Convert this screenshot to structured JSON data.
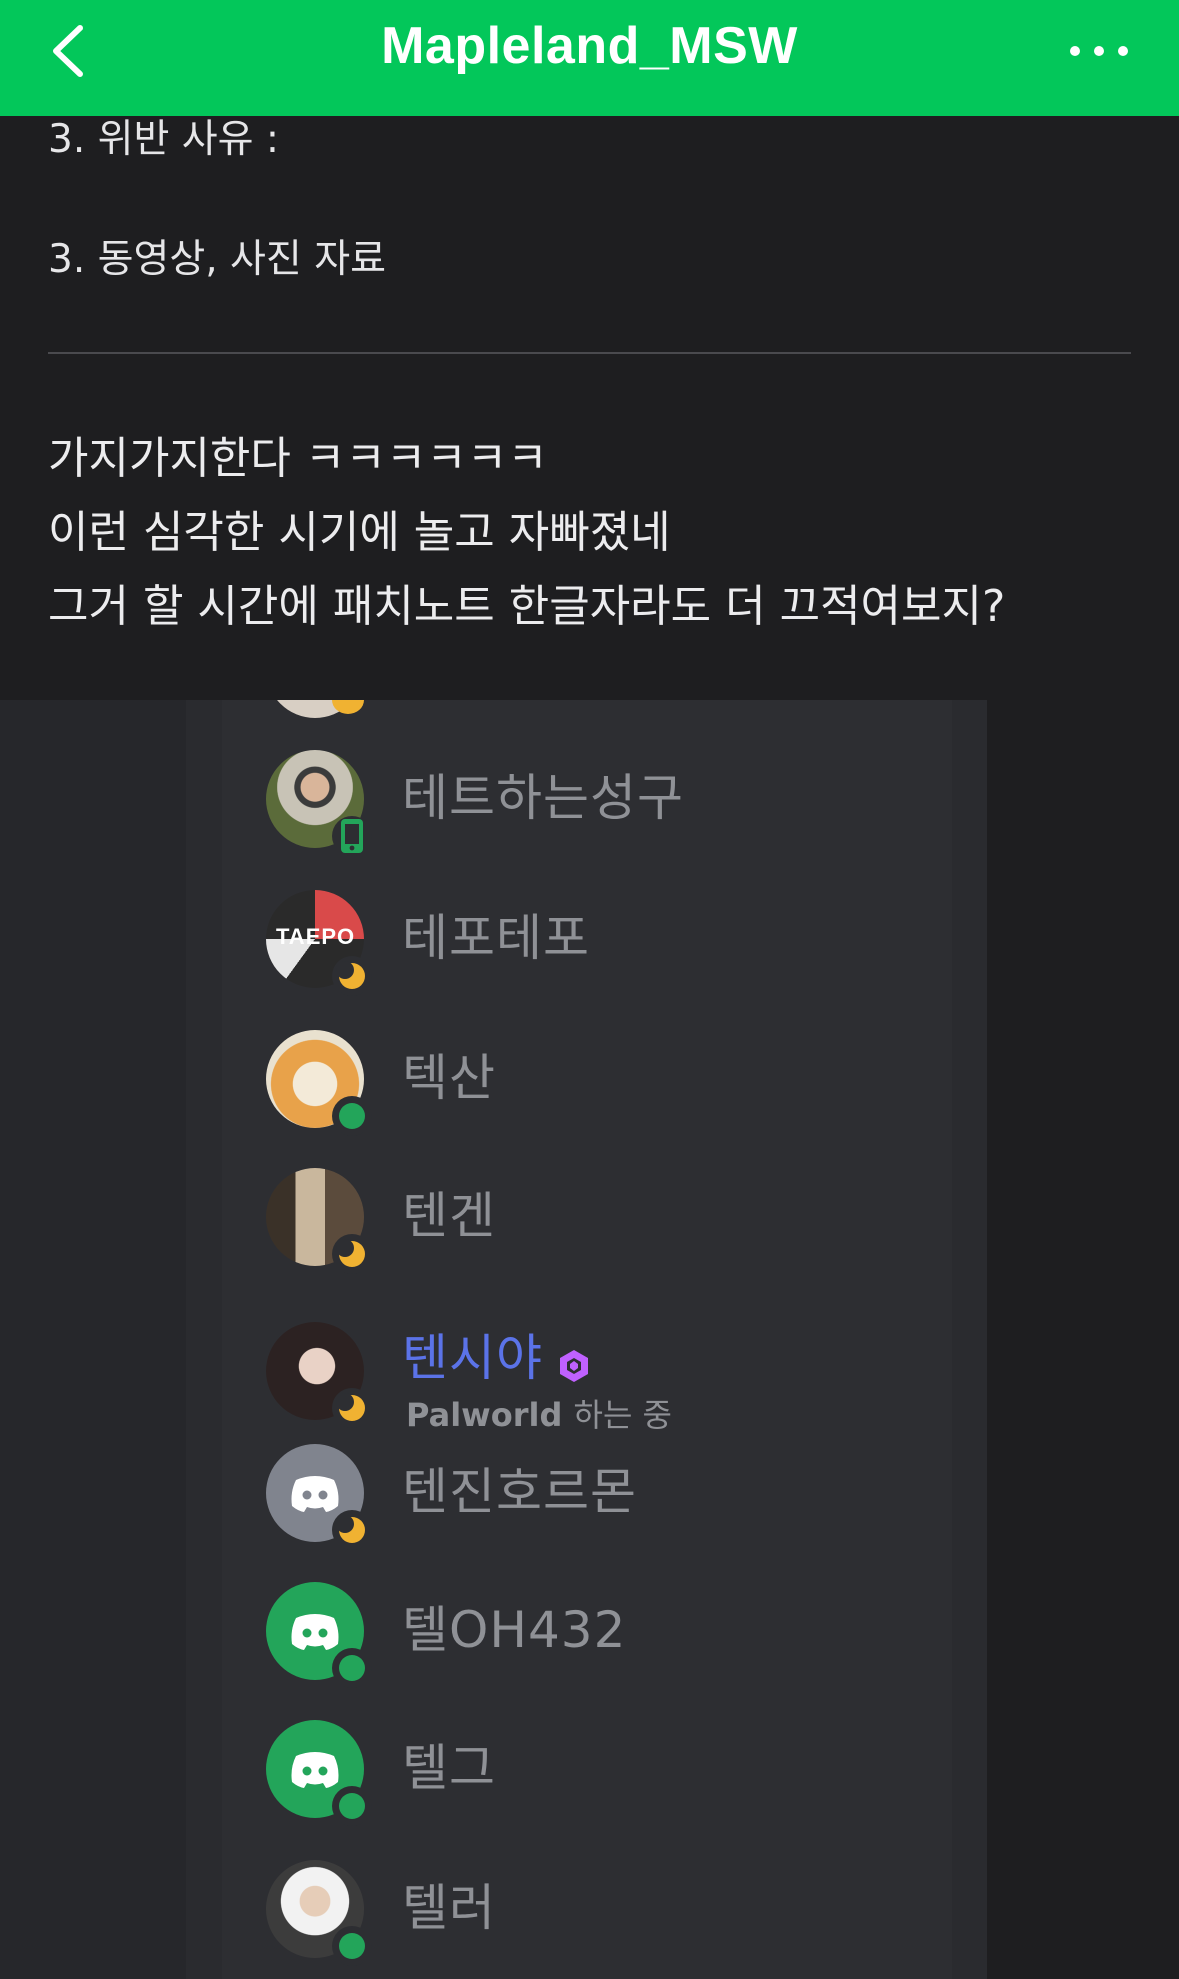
{
  "header": {
    "title": "Mapleland_MSW",
    "back_icon": "chevron-left-icon",
    "more_icon": "more-horizontal-icon",
    "bg_color": "#03c75a"
  },
  "article": {
    "items": [
      "3. 위반 사유 :",
      "3. 동영상, 사진 자료"
    ],
    "comment_lines": [
      "가지가지한다 ㅋㅋㅋㅋㅋㅋ",
      "이런 심각한 시기에 놀고 자빠졌네",
      "그거 할 시간에 패치노트 한글자라도 더 끄적여보지?"
    ]
  },
  "screenshot": {
    "members": [
      {
        "name": "테트하는성구",
        "status": "mobile",
        "highlight": false
      },
      {
        "name": "테포테포",
        "status": "idle",
        "highlight": false,
        "avatar_text": "TAEPO"
      },
      {
        "name": "텍산",
        "status": "online",
        "highlight": false
      },
      {
        "name": "텐겐",
        "status": "idle",
        "highlight": false
      },
      {
        "name": "텐시야",
        "status": "idle",
        "highlight": true,
        "activity_game": "Palworld",
        "activity_suffix": "하는 중"
      },
      {
        "name": "텐진호르몬",
        "status": "idle",
        "highlight": false
      },
      {
        "name": "텔OH432",
        "status": "online",
        "highlight": false
      },
      {
        "name": "텔그",
        "status": "online",
        "highlight": false
      },
      {
        "name": "텔러",
        "status": "online",
        "highlight": false
      }
    ],
    "colors": {
      "online": "#23a55a",
      "idle": "#f0b232",
      "name": "#8f9196",
      "highlight_name": "#5b73e8",
      "nitro": "#c061ff"
    }
  }
}
